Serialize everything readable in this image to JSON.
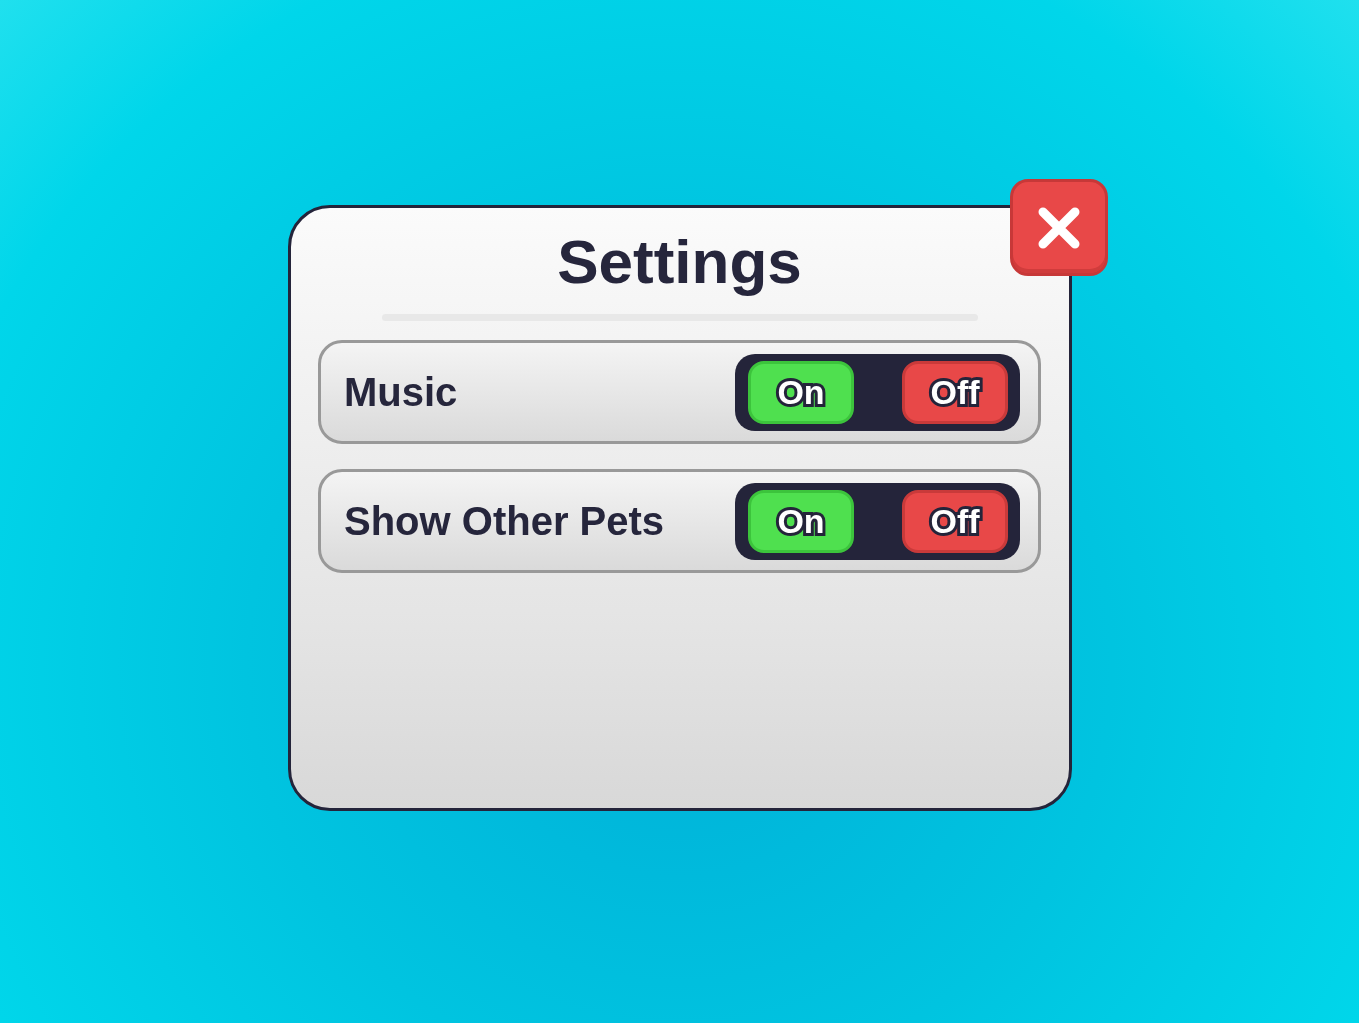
{
  "window": {
    "title": "Settings"
  },
  "rows": [
    {
      "label": "Music",
      "buttons": [
        {
          "label": "On",
          "kind": "on"
        },
        {
          "label": "Off",
          "kind": "off"
        }
      ]
    },
    {
      "label": "Show Other Pets",
      "buttons": [
        {
          "label": "On",
          "kind": "on"
        },
        {
          "label": "Off",
          "kind": "off"
        }
      ]
    }
  ]
}
